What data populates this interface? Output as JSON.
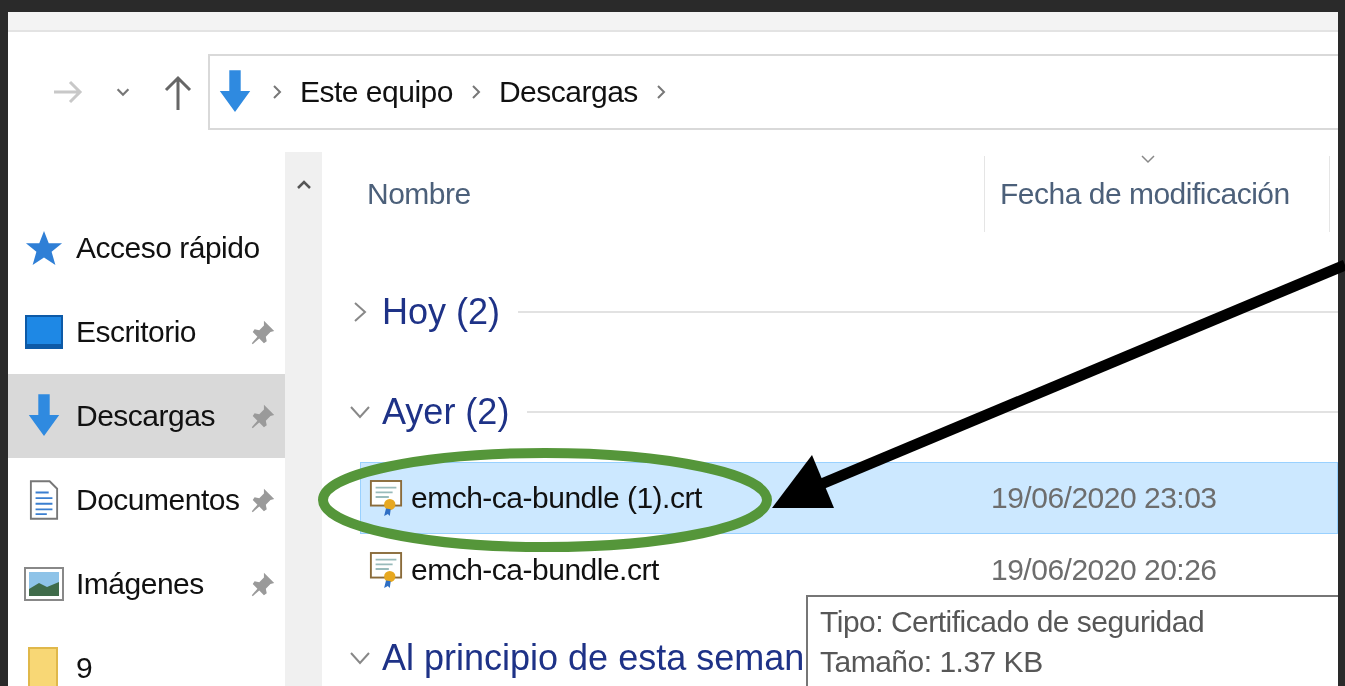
{
  "nav_buttons": [
    {
      "kind": "forward",
      "disabled": true
    },
    {
      "kind": "recent",
      "disabled": false
    },
    {
      "kind": "up",
      "disabled": false
    }
  ],
  "address_bar": {
    "breadcrumb": [
      "Este equipo",
      "Descargas"
    ]
  },
  "sidebar": {
    "items": [
      {
        "label": "Acceso rápido",
        "kind": "star",
        "pinned": false,
        "selected": false
      },
      {
        "label": "Escritorio",
        "kind": "desktop",
        "pinned": true,
        "selected": false
      },
      {
        "label": "Descargas",
        "kind": "download",
        "pinned": true,
        "selected": true
      },
      {
        "label": "Documentos",
        "kind": "document",
        "pinned": true,
        "selected": false
      },
      {
        "label": "Imágenes",
        "kind": "pictures",
        "pinned": true,
        "selected": false
      },
      {
        "label": "9",
        "kind": "folder",
        "pinned": false,
        "selected": false
      }
    ]
  },
  "columns": [
    {
      "label": "Nombre",
      "sorted": false
    },
    {
      "label": "Fecha de modificación",
      "sorted": true
    }
  ],
  "groups": [
    {
      "label": "Hoy (2)",
      "expanded": false
    },
    {
      "label": "Ayer (2)",
      "expanded": true,
      "files": [
        {
          "name": "emch-ca-bundle (1).crt",
          "date": "19/06/2020 23:03",
          "selected": true
        },
        {
          "name": "emch-ca-bundle.crt",
          "date": "19/06/2020 20:26",
          "selected": false
        }
      ]
    },
    {
      "label": "Al principio de esta seman",
      "expanded": true
    }
  ],
  "tooltip": {
    "lines": [
      "Tipo: Certificado de seguridad",
      "Tamaño: 1.37 KB"
    ]
  }
}
